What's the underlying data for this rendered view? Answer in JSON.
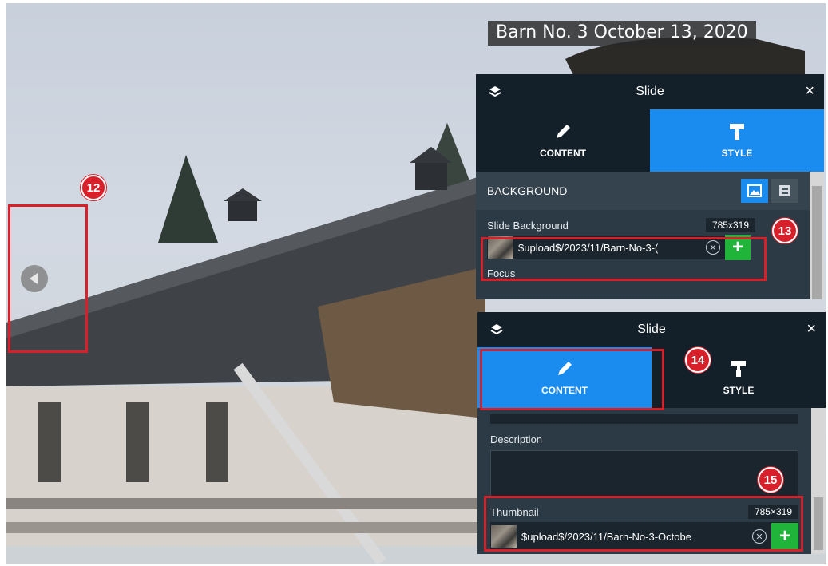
{
  "photo": {
    "caption": "Barn No. 3 October 13, 2020"
  },
  "callouts": {
    "c12": "12",
    "c13": "13",
    "c14": "14",
    "c15": "15"
  },
  "panel_style": {
    "title": "Slide",
    "close": "×",
    "tabs": [
      {
        "label": "CONTENT",
        "icon": "pencil-icon"
      },
      {
        "label": "STYLE",
        "icon": "paint-roller-icon"
      }
    ],
    "active_tab": "STYLE",
    "section": "BACKGROUND",
    "field_label": "Slide Background",
    "dimensions": "785x319",
    "file_value": "$upload$/2023/11/Barn-No-3-(",
    "focus_label": "Focus"
  },
  "panel_content": {
    "title": "Slide",
    "close": "×",
    "tabs": [
      {
        "label": "CONTENT",
        "icon": "pencil-icon"
      },
      {
        "label": "STYLE",
        "icon": "paint-roller-icon"
      }
    ],
    "active_tab": "CONTENT",
    "description_label": "Description",
    "description_value": "",
    "thumbnail_label": "Thumbnail",
    "dimensions": "785×319",
    "file_value": "$upload$/2023/11/Barn-No-3-Octobe"
  },
  "colors": {
    "accent": "#1a8cf0",
    "panel_bg": "#2b3a45",
    "header_bg": "#13202a",
    "callout": "#d8202a",
    "add": "#20b53a"
  }
}
